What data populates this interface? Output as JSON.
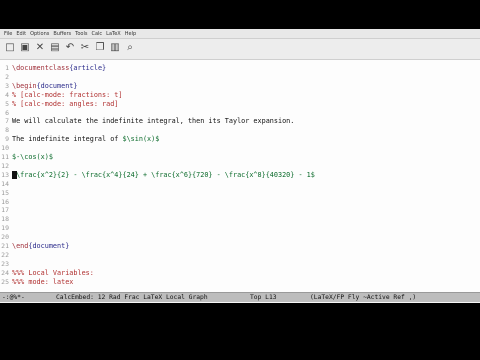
{
  "menubar": {
    "items": [
      "File",
      "Edit",
      "Options",
      "Buffers",
      "Tools",
      "Calc",
      "LaTeX",
      "Help"
    ]
  },
  "toolbar": {
    "icons": [
      "new-file-icon",
      "open-file-icon",
      "close-icon",
      "save-icon",
      "undo-icon",
      "cut-icon",
      "copy-icon",
      "paste-icon",
      "search-icon"
    ]
  },
  "editor": {
    "lines": [
      {
        "n": "1",
        "parts": [
          [
            "kw",
            "\\documentclass"
          ],
          [
            "arg",
            "{article}"
          ]
        ]
      },
      {
        "n": "2",
        "parts": []
      },
      {
        "n": "3",
        "parts": [
          [
            "kw",
            "\\begin"
          ],
          [
            "arg",
            "{document}"
          ]
        ]
      },
      {
        "n": "4",
        "parts": [
          [
            "cmt",
            "% [calc-mode: fractions: t]"
          ]
        ]
      },
      {
        "n": "5",
        "parts": [
          [
            "cmt",
            "% [calc-mode: angles: rad]"
          ]
        ]
      },
      {
        "n": "6",
        "parts": []
      },
      {
        "n": "7",
        "parts": [
          [
            "eq",
            "We will calculate the indefinite integral, then its Taylor expansion."
          ]
        ]
      },
      {
        "n": "8",
        "parts": []
      },
      {
        "n": "9",
        "parts": [
          [
            "eq",
            "The indefinite integral of "
          ],
          [
            "dollar",
            "$\\sin(x)$"
          ]
        ]
      },
      {
        "n": "10",
        "parts": []
      },
      {
        "n": "11",
        "parts": [
          [
            "dollar",
            "$-\\cos(x)$"
          ]
        ]
      },
      {
        "n": "12",
        "parts": []
      },
      {
        "n": "13",
        "parts": [
          [
            "dollar",
            "$\\frac{x^2}{2} - \\frac{x^4}{24} + \\frac{x^6}{720} - \\frac{x^8}{40320} - 1$"
          ]
        ]
      },
      {
        "n": "14",
        "parts": []
      },
      {
        "n": "15",
        "parts": []
      },
      {
        "n": "16",
        "parts": []
      },
      {
        "n": "17",
        "parts": []
      },
      {
        "n": "18",
        "parts": []
      },
      {
        "n": "19",
        "parts": []
      },
      {
        "n": "20",
        "parts": []
      },
      {
        "n": "21",
        "parts": [
          [
            "kw",
            "\\end"
          ],
          [
            "arg",
            "{document}"
          ]
        ]
      },
      {
        "n": "22",
        "parts": []
      },
      {
        "n": "23",
        "parts": []
      },
      {
        "n": "24",
        "parts": [
          [
            "cmt",
            "%%% Local Variables:"
          ]
        ]
      },
      {
        "n": "25",
        "parts": [
          [
            "cmt",
            "%%% mode: latex"
          ]
        ]
      }
    ],
    "cursor_line": "13"
  },
  "modeline": {
    "status": "-:@%*-",
    "modes": "CalcEmbed: 12 Rad Frac LaTeX Local Graph",
    "position": "Top L13",
    "major": "(LaTeX/FP Fly ~Active Ref ,)"
  }
}
